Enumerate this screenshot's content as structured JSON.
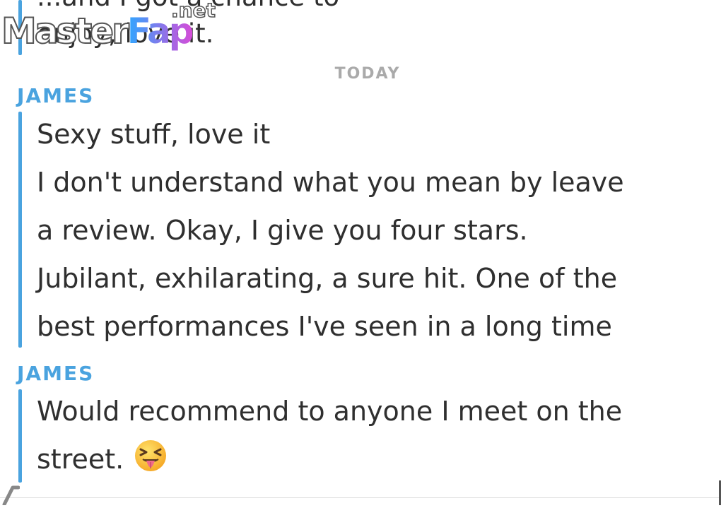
{
  "previous_message": {
    "line_1": "...and I got a chance to",
    "line_2": "enjoy, love it."
  },
  "watermark": {
    "main": "Master",
    "accent": "Fap",
    "tld": ".net"
  },
  "date_separator": "TODAY",
  "conversation": [
    {
      "sender": "JAMES",
      "lines": [
        "Sexy stuff, love it",
        "I don't understand what you mean by leave",
        "a review. Okay, I give you four stars.",
        "Jubilant, exhilarating, a sure hit. One of the",
        "best performances I've seen in a long time"
      ]
    },
    {
      "sender": "JAMES",
      "lines": [
        "Would recommend to anyone I meet on the",
        "street."
      ],
      "emoji": "squinting-face-with-tongue-icon"
    }
  ],
  "colors": {
    "accent": "#4aa3df",
    "text": "#2f2f2f",
    "separator": "#aaaaaa"
  }
}
